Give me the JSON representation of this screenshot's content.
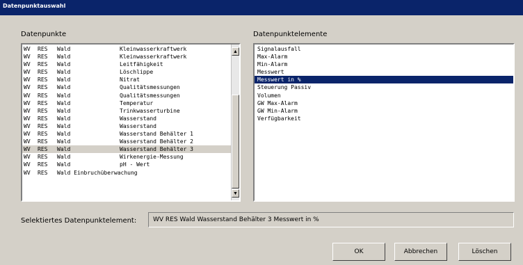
{
  "window": {
    "title": "Datenpunktauswahl"
  },
  "labels": {
    "datapoints": "Datenpunkte",
    "elements": "Datenpunktelemente",
    "selected": "Selektiertes Datenpunktelement:"
  },
  "datapoints": [
    {
      "c1": "WV",
      "c2": "RES",
      "c3": "Wald",
      "c4": "Kleinwasserkraftwerk"
    },
    {
      "c1": "WV",
      "c2": "RES",
      "c3": "Wald",
      "c4": "Kleinwasserkraftwerk"
    },
    {
      "c1": "WV",
      "c2": "RES",
      "c3": "Wald",
      "c4": "Leitfähigkeit"
    },
    {
      "c1": "WV",
      "c2": "RES",
      "c3": "Wald",
      "c4": "Löschlippe"
    },
    {
      "c1": "WV",
      "c2": "RES",
      "c3": "Wald",
      "c4": "Nitrat"
    },
    {
      "c1": "WV",
      "c2": "RES",
      "c3": "Wald",
      "c4": "Qualitätsmessungen"
    },
    {
      "c1": "WV",
      "c2": "RES",
      "c3": "Wald",
      "c4": "Qualitätsmessungen"
    },
    {
      "c1": "WV",
      "c2": "RES",
      "c3": "Wald",
      "c4": "Temperatur"
    },
    {
      "c1": "WV",
      "c2": "RES",
      "c3": "Wald",
      "c4": "Trinkwasserturbine"
    },
    {
      "c1": "WV",
      "c2": "RES",
      "c3": "Wald",
      "c4": "Wasserstand"
    },
    {
      "c1": "WV",
      "c2": "RES",
      "c3": "Wald",
      "c4": "Wasserstand"
    },
    {
      "c1": "WV",
      "c2": "RES",
      "c3": "Wald",
      "c4": "Wasserstand Behälter 1"
    },
    {
      "c1": "WV",
      "c2": "RES",
      "c3": "Wald",
      "c4": "Wasserstand Behälter 2"
    },
    {
      "c1": "WV",
      "c2": "RES",
      "c3": "Wald",
      "c4": "Wasserstand Behälter 3",
      "selected": true
    },
    {
      "c1": "WV",
      "c2": "RES",
      "c3": "Wald",
      "c4": "Wirkenergie-Messung"
    },
    {
      "c1": "WV",
      "c2": "RES",
      "c3": "Wald",
      "c4": "pH - Wert"
    },
    {
      "c1": "WV",
      "c2": "RES",
      "c3": "Wald Einbruchüberwachung",
      "c4": ""
    }
  ],
  "elements": [
    {
      "label": "Signalausfall"
    },
    {
      "label": "Max-Alarm"
    },
    {
      "label": "Min-Alarm"
    },
    {
      "label": "Messwert"
    },
    {
      "label": "Messwert in %",
      "selected": true
    },
    {
      "label": "Steuerung Passiv"
    },
    {
      "label": "Volumen"
    },
    {
      "label": "GW Max-Alarm"
    },
    {
      "label": "GW Min-Alarm"
    },
    {
      "label": "Verfügbarkeit"
    }
  ],
  "selected_value": "WV  RES Wald  Wasserstand Behälter 3  Messwert in %",
  "buttons": {
    "ok": "OK",
    "cancel": "Abbrechen",
    "delete": "Löschen"
  },
  "icons": {
    "scroll_up": "▲",
    "scroll_down": "▼"
  },
  "colors": {
    "titlebar": "#0a246a",
    "selection": "#0a246a",
    "dialog": "#d4d0c8"
  }
}
